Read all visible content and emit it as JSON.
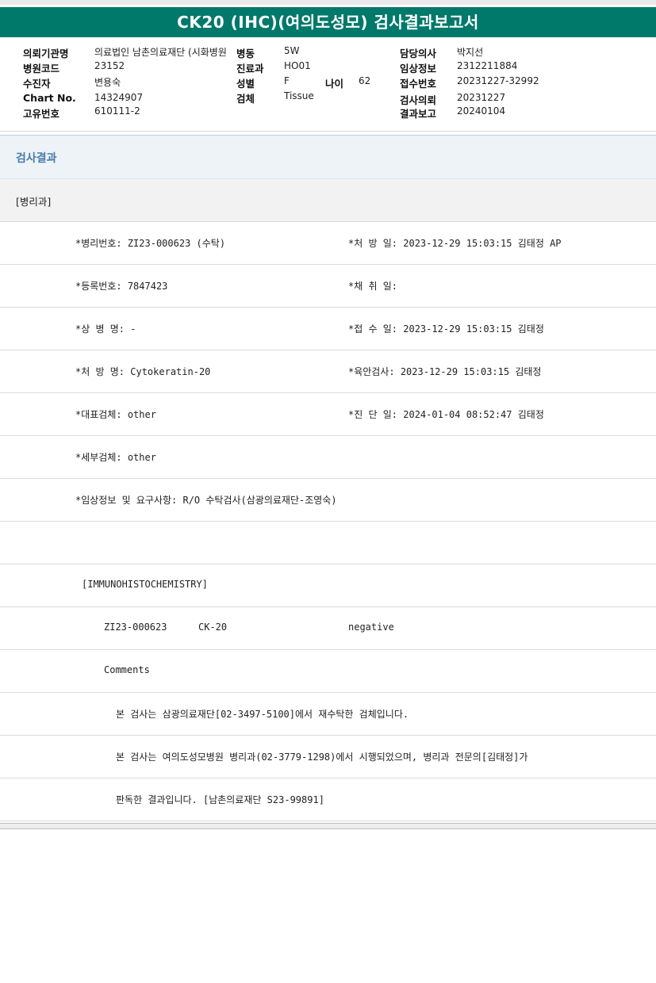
{
  "title": "CK20 (IHC)(여의도성모) 검사결과보고서",
  "header": {
    "institution_label": "의뢰기관명",
    "institution_value": "의료법인 남촌의료재단 (시화병원",
    "ward_label": "병동",
    "ward_value": "5W",
    "doctor_label": "담당의사",
    "doctor_value": "박지선",
    "hospital_code_label": "병원코드",
    "hospital_code_value": "23152",
    "dept_label": "진료과",
    "dept_value": "HO01",
    "clinical_label": "임상정보",
    "clinical_value": "2312211884",
    "patient_label": "수진자",
    "patient_value": "변용숙",
    "sex_label": "성별",
    "sex_value": "F",
    "age_label": "나이",
    "age_value": "62",
    "receipt_label": "접수번호",
    "receipt_value": "20231227-32992",
    "chart_label": "Chart No.",
    "chart_value": "14324907",
    "specimen_label": "검체",
    "specimen_value": "Tissue",
    "request_label": "검사의뢰",
    "request_value": "20231227",
    "unique_label": "고유번호",
    "unique_value": "610111-2",
    "report_label": "결과보고",
    "report_value": "20240104"
  },
  "result_title": "검사결과",
  "dept_section": "[병리과]",
  "rows": [
    {
      "left": "*병리번호: ZI23-000623 (수탁)",
      "right": "*처 방 일: 2023-12-29 15:03:15  김태정 AP"
    },
    {
      "left": "*등록번호: 7847423",
      "right": "*채 취 일:"
    },
    {
      "left": "*상 병 명: -",
      "right": "*접 수 일: 2023-12-29 15:03:15  김태정"
    },
    {
      "left": "*처 방 명: Cytokeratin-20",
      "right": "*육안검사: 2023-12-29 15:03:15  김태정"
    },
    {
      "left": "*대표검체: other",
      "right": "*진 단 일: 2024-01-04 08:52:47  김태정"
    },
    {
      "left": "*세부검체: other",
      "right": ""
    },
    {
      "left": "*임상정보 및 요구사항: R/O 수탁검사(삼광의료재단-조영숙)",
      "right": ""
    },
    {
      "left": "",
      "right": ""
    }
  ],
  "ihc": {
    "section": "[IMMUNOHISTOCHEMISTRY]",
    "case_no": "ZI23-000623",
    "marker": "CK-20",
    "result": "negative",
    "comments_label": "Comments",
    "comment_lines": [
      "본 검사는 삼광의료재단[02-3497-5100]에서 재수탁한 검체입니다.",
      "본 검사는 여의도성모병원 병리과(02-3779-1298)에서 시행되었으며, 병리과 전문의[김태정]가",
      "판독한 결과입니다. [남촌의료재단 S23-99891]"
    ]
  }
}
